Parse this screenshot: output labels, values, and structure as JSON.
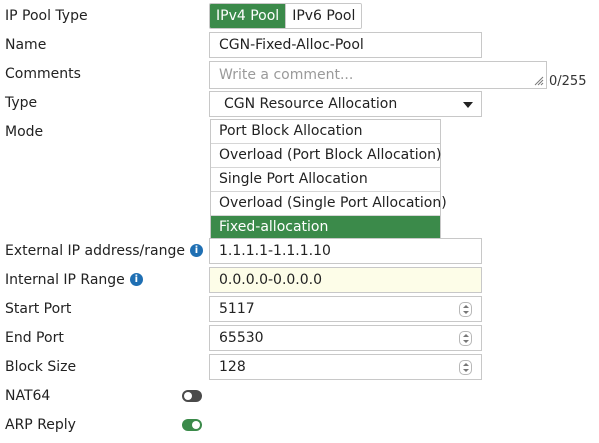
{
  "labels": {
    "ip_pool_type": "IP Pool Type",
    "name": "Name",
    "comments": "Comments",
    "type": "Type",
    "mode": "Mode",
    "external_ip": "External IP address/range",
    "internal_ip": "Internal IP Range",
    "start_port": "Start Port",
    "end_port": "End Port",
    "block_size": "Block Size",
    "nat64": "NAT64",
    "arp_reply": "ARP Reply"
  },
  "pool_type": {
    "options": [
      "IPv4 Pool",
      "IPv6 Pool"
    ],
    "selected": "IPv4 Pool"
  },
  "name_value": "CGN-Fixed-Alloc-Pool",
  "comments": {
    "placeholder": "Write a comment...",
    "counter": "0/255"
  },
  "type_value": "CGN Resource Allocation",
  "mode": {
    "options": [
      "Port Block Allocation",
      "Overload (Port Block Allocation)",
      "Single Port Allocation",
      "Overload (Single Port Allocation)",
      "Fixed-allocation"
    ],
    "selected": "Fixed-allocation"
  },
  "external_ip_value": "1.1.1.1-1.1.1.10",
  "internal_ip_value": "0.0.0.0-0.0.0.0",
  "start_port_value": "5117",
  "end_port_value": "65530",
  "block_size_value": "128",
  "nat64": {
    "enabled": false
  },
  "arp_reply": {
    "enabled": true
  },
  "icons": {
    "info": "info-icon",
    "dropdown": "chevron-down-icon",
    "stepper": "spinner-icon"
  },
  "colors": {
    "accent_green": "#3b8a4a",
    "info_blue": "#1f6fb3",
    "highlight_field": "#fdfde8"
  }
}
